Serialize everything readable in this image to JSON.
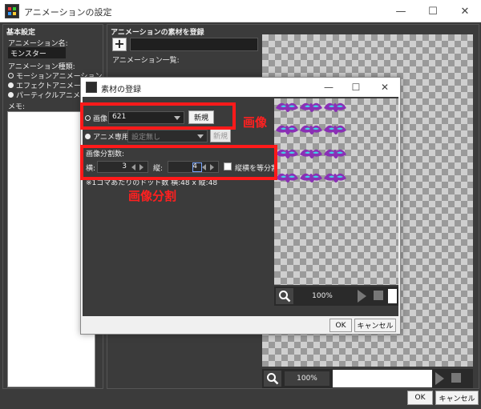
{
  "window": {
    "title": "アニメーションの設定",
    "minimize": "—",
    "maximize": "☐",
    "close": "✕"
  },
  "left": {
    "section_title": "基本設定",
    "name_label": "アニメーション名:",
    "name_value": "モンスター",
    "type_label": "アニメーション種類:",
    "types": [
      {
        "label": "モーションアニメーション",
        "selected": true
      },
      {
        "label": "エフェクトアニメーション",
        "selected": false
      },
      {
        "label": "パーティクルアニメーション",
        "selected": false
      }
    ],
    "memo_label": "メモ:"
  },
  "right": {
    "title": "アニメーションの素材を登録",
    "add": "+",
    "list_label": "アニメーション一覧:",
    "zoom": "100%"
  },
  "footer": {
    "ok": "OK",
    "cancel": "キャンセル"
  },
  "dialog": {
    "title": "素材の登録",
    "minimize": "—",
    "maximize": "☐",
    "close": "✕",
    "image_radio": "画像",
    "image_value": "621",
    "new_button": "新規",
    "anim_radio": "アニメ専用",
    "anim_value": "設定無し",
    "anim_new_button": "新規",
    "split_label": "画像分割数:",
    "horiz_label": "横:",
    "horiz_value": "3",
    "vert_label": "縦:",
    "vert_value": "4",
    "equal_split_label": "縦横を等分割",
    "dot_info": "※1コマあたりのドット数 横:48 x 縦:48",
    "zoom": "100%",
    "ok": "OK",
    "cancel": "キャンセル"
  },
  "annotations": {
    "image": "画像",
    "split": "画像分割"
  },
  "colors": {
    "annotation_red": "#ff1a1a",
    "bat_purple": "#8a2fb5",
    "bat_cyan": "#3fd7e6"
  }
}
